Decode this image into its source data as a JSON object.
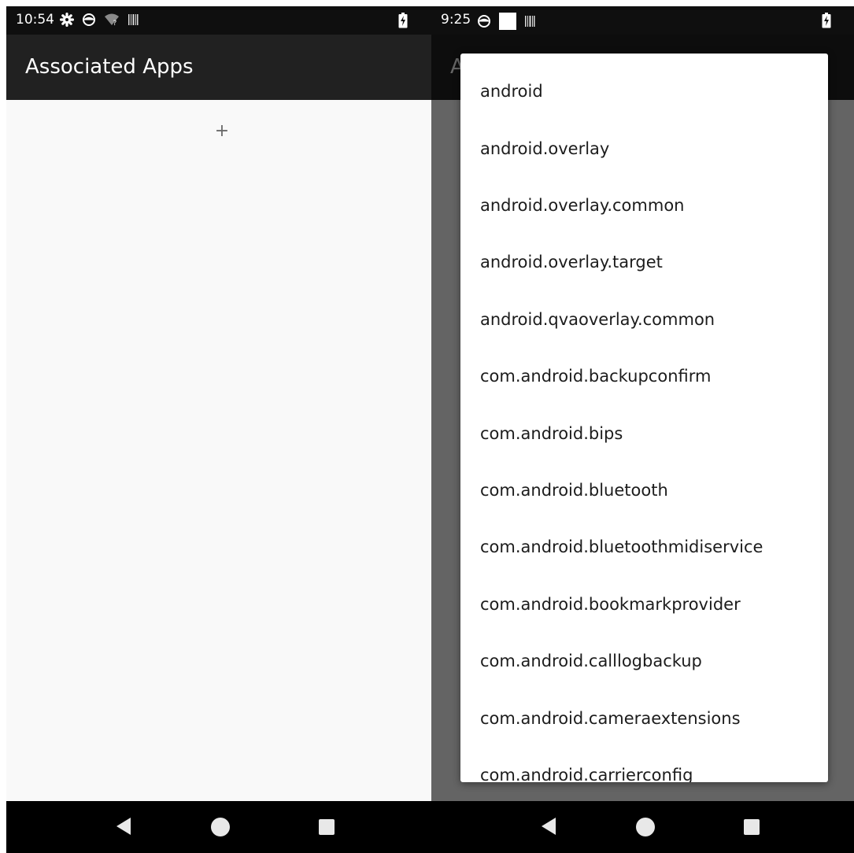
{
  "left_screen": {
    "status_bar": {
      "time": "10:54",
      "icons": [
        "settings-icon",
        "sync-icon",
        "wifi-unknown-icon",
        "barcode-icon",
        "battery-charging-icon"
      ]
    },
    "app_bar": {
      "title": "Associated Apps"
    },
    "add_button_label": "+",
    "nav_bar": {
      "buttons": [
        "back-icon",
        "home-icon",
        "recents-icon"
      ]
    }
  },
  "right_screen": {
    "status_bar": {
      "time": "9:25",
      "icons": [
        "sync-icon",
        "notification-square-icon",
        "barcode-icon",
        "battery-charging-icon"
      ]
    },
    "app_bar": {
      "title_fragment": "A"
    },
    "package_list": [
      "android",
      "android.overlay",
      "android.overlay.common",
      "android.overlay.target",
      "android.qvaoverlay.common",
      "com.android.backupconfirm",
      "com.android.bips",
      "com.android.bluetooth",
      "com.android.bluetoothmidiservice",
      "com.android.bookmarkprovider",
      "com.android.calllogbackup",
      "com.android.cameraextensions",
      "com.android.carrierconfig"
    ],
    "nav_bar": {
      "buttons": [
        "back-icon",
        "home-icon",
        "recents-icon"
      ]
    }
  },
  "colors": {
    "status_bar": "#0f0f0f",
    "app_bar": "#212121",
    "content_background": "#f9f9f9",
    "nav_bar": "#000000",
    "scrim": "#666666",
    "popup_background": "#ffffff"
  }
}
